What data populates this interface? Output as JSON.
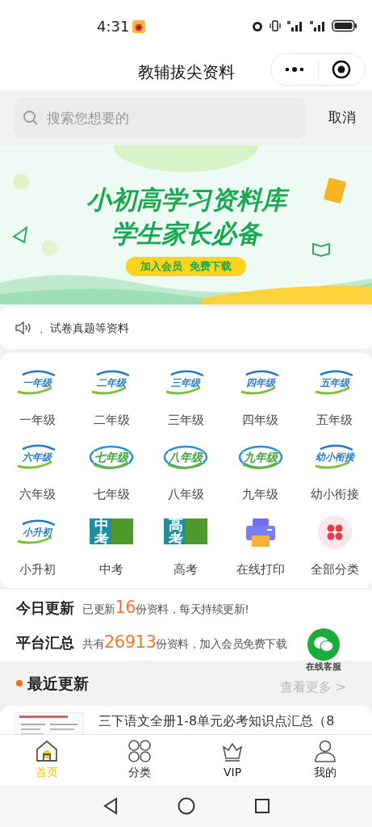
{
  "status_bar": {
    "time": "4:31"
  },
  "nav": {
    "title": "教辅拔尖资料"
  },
  "search": {
    "placeholder": "搜索您想要的",
    "cancel": "取消"
  },
  "banner": {
    "headline": "小初高学习资料库",
    "subline": "学生家长必备",
    "button": "加入会员  免费下载"
  },
  "notice": {
    "text": "、试卷真题等资料"
  },
  "categories": [
    {
      "kind": "grade",
      "logo_text": "一年级",
      "label": "一年级"
    },
    {
      "kind": "grade",
      "logo_text": "二年级",
      "label": "二年级"
    },
    {
      "kind": "grade",
      "logo_text": "三年级",
      "label": "三年级"
    },
    {
      "kind": "grade",
      "logo_text": "四年级",
      "label": "四年级"
    },
    {
      "kind": "grade",
      "logo_text": "五年级",
      "label": "五年级"
    },
    {
      "kind": "grade",
      "logo_text": "六年级",
      "label": "六年级"
    },
    {
      "kind": "orbit",
      "logo_text": "七年级",
      "label": "七年级"
    },
    {
      "kind": "orbit",
      "logo_text": "八年级",
      "label": "八年级"
    },
    {
      "kind": "orbit",
      "logo_text": "九年级",
      "label": "九年级"
    },
    {
      "kind": "grade",
      "logo_text": "幼小衔接",
      "label": "幼小衔接"
    },
    {
      "kind": "grade",
      "logo_text": "小升初",
      "label": "小升初"
    },
    {
      "kind": "book",
      "logo_text": "中考",
      "label": "中考"
    },
    {
      "kind": "book",
      "logo_text": "高考",
      "label": "高考"
    },
    {
      "kind": "printer",
      "label": "在线打印"
    },
    {
      "kind": "all",
      "label": "全部分类"
    }
  ],
  "stats": [
    {
      "label": "今日更新",
      "before": "已更新",
      "count": "16",
      "after": "份资料，每天持续更新!"
    },
    {
      "label": "平台汇总",
      "before": "共有",
      "count": "26913",
      "after": "份资料，加入会员免费下载"
    }
  ],
  "recent": {
    "title": "最近更新",
    "more": "查看更多 >",
    "items": [
      {
        "title": "三下语文全册1-8单元必考知识点汇总（8"
      }
    ]
  },
  "service": {
    "label": "在线客服"
  },
  "tabs": [
    {
      "label": "首页",
      "selected": true
    },
    {
      "label": "分类",
      "selected": false
    },
    {
      "label": "VIP",
      "selected": false
    },
    {
      "label": "我的",
      "selected": false
    }
  ]
}
